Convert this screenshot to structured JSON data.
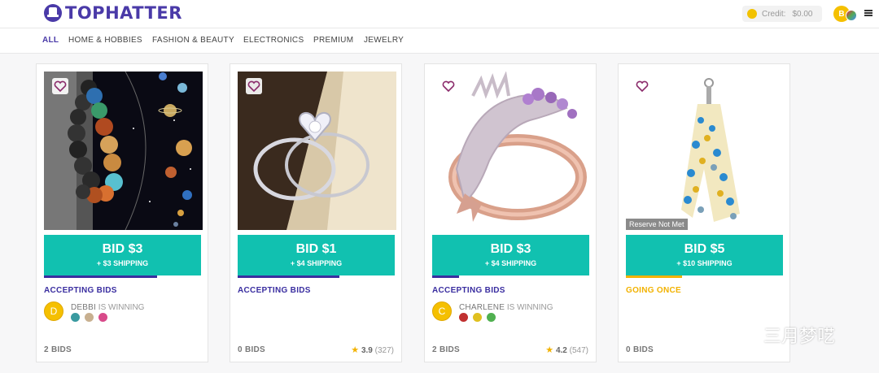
{
  "brand": {
    "name": "TOPHATTER",
    "color": "#4a3aa8"
  },
  "header": {
    "credit_label": "Credit:",
    "credit_value": "$0.00",
    "user_initial": "B"
  },
  "nav": [
    "ALL",
    "HOME & HOBBIES",
    "FASHION & BEAUTY",
    "ELECTRONICS",
    "PREMIUM",
    "JEWELRY"
  ],
  "colors": {
    "bid": "#11c1b0",
    "accepting": "#3a2ea0",
    "going": "#f2b200"
  },
  "products": [
    {
      "image": "solar-system-bead-bracelet",
      "bid_label": "BID $3",
      "shipping": "+ $3 SHIPPING",
      "progress": 0.72,
      "status": "ACCEPTING BIDS",
      "winner": {
        "initial": "D",
        "name": "DEBBI",
        "suffix": " IS WINNING"
      },
      "bids": "2 BIDS"
    },
    {
      "image": "crystal-heart-ring",
      "bid_label": "BID $1",
      "shipping": "+ $4 SHIPPING",
      "progress": 0.65,
      "status": "ACCEPTING BIDS",
      "bids": "0 BIDS",
      "rating": "3.9",
      "reviews": "(327)"
    },
    {
      "image": "dragon-ring",
      "bid_label": "BID $3",
      "shipping": "+ $4 SHIPPING",
      "progress": 0.17,
      "status": "ACCEPTING BIDS",
      "winner": {
        "initial": "C",
        "name": "CHARLENE",
        "suffix": " IS WINNING"
      },
      "bids": "2 BIDS",
      "rating": "4.2",
      "reviews": "(547)"
    },
    {
      "image": "polka-dot-scarf-keychain",
      "reserve": "Reserve Not Met",
      "bid_label": "BID $5",
      "shipping": "+ $10 SHIPPING",
      "progress": 0.36,
      "status": "GOING ONCE",
      "bids": "0 BIDS"
    }
  ],
  "watermark": "三月梦呓"
}
